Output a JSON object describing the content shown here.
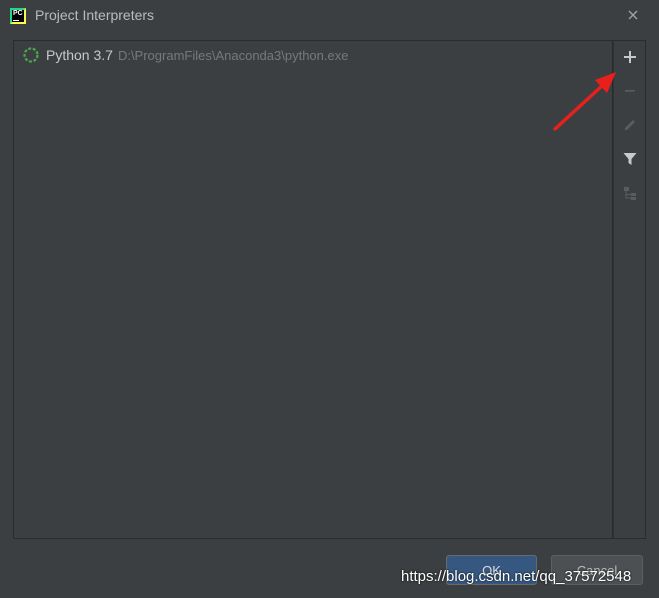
{
  "window": {
    "title": "Project Interpreters",
    "app_icon_text": "PC"
  },
  "interpreters": [
    {
      "name": "Python 3.7",
      "path": "D:\\ProgramFiles\\Anaconda3\\python.exe"
    }
  ],
  "toolbar": {
    "add_icon": "plus-icon",
    "remove_icon": "minus-icon",
    "edit_icon": "pencil-icon",
    "filter_icon": "filter-icon",
    "tree_icon": "tree-paths-icon"
  },
  "buttons": {
    "ok_label": "OK",
    "cancel_label": "Cancel"
  },
  "watermark": "https://blog.csdn.net/qq_37572548",
  "colors": {
    "background": "#3c3f41",
    "annotation_arrow": "#e8201c",
    "interpreter_icon": "#4aa84a"
  }
}
